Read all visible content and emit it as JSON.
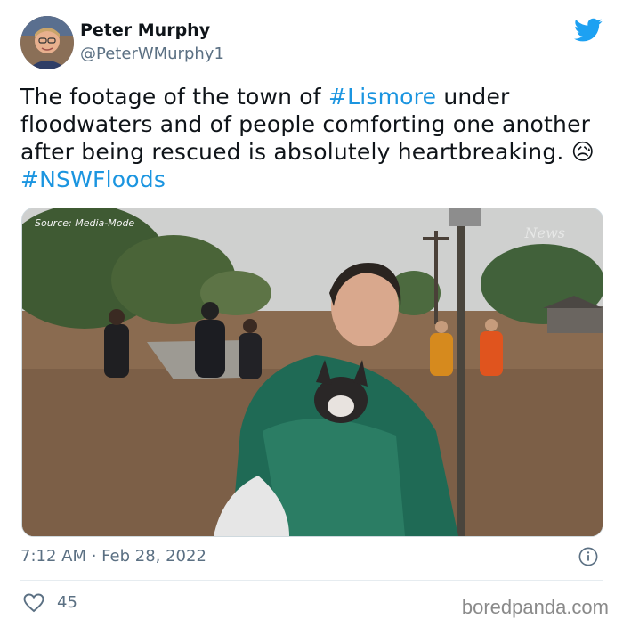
{
  "author": {
    "name": "Peter Murphy",
    "handle": "@PeterWMurphy1"
  },
  "tweet": {
    "line1_pre": "The footage of the town of ",
    "tag1": "#Lismore",
    "line1_post": " under floodwaters and of people comforting one another after being rescued is absolutely heartbreaking. ",
    "emoji": "😥",
    "tag2": "#NSWFloods"
  },
  "media": {
    "source_label": "Source: Media-Mode",
    "news_label": "News"
  },
  "timestamp": "7:12 AM · Feb 28, 2022",
  "likes": "45",
  "watermark": "boredpanda.com",
  "colors": {
    "hashtag": "#1b95e0",
    "twitter_blue": "#1da1f2",
    "secondary_text": "#5b7083"
  },
  "icons": [
    "twitter-bird-icon",
    "info-icon",
    "heart-icon"
  ]
}
